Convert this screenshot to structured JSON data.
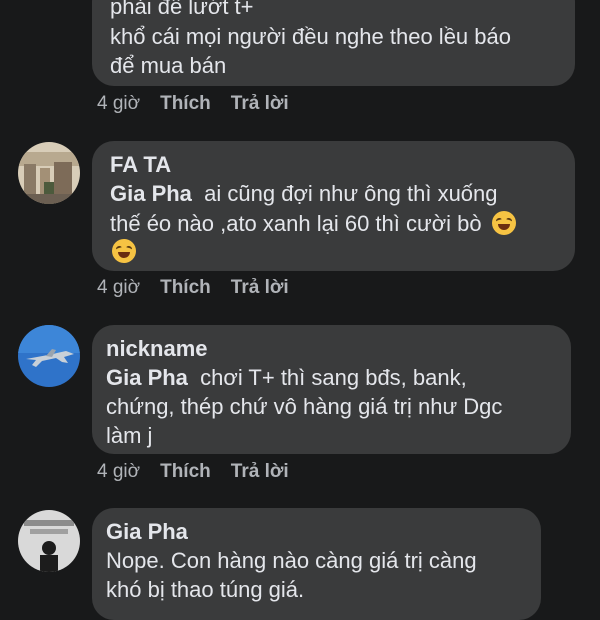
{
  "comment0": {
    "lines": [
      "phải để lướt t+",
      "khổ cái mọi người đều nghe theo lều báo",
      "để mua bán"
    ],
    "time": "4 giờ",
    "like": "Thích",
    "reply": "Trả lời"
  },
  "comment1": {
    "author": "FA TA",
    "mention": "Gia Pha",
    "line1": "ai cũng đợi như ông thì xuống",
    "line2": "thế éo nào ,ato xanh lại 60 thì cười bò",
    "emoji": "rolling-on-floor-laughing-emoji",
    "time": "4 giờ",
    "like": "Thích",
    "reply": "Trả lời"
  },
  "comment2": {
    "author": "nickname",
    "mention": "Gia Pha",
    "line1": "chơi T+ thì sang bđs, bank,",
    "line2": "chứng, thép chứ vô hàng giá trị như Dgc",
    "line3": "làm j",
    "time": "4 giờ",
    "like": "Thích",
    "reply": "Trả lời"
  },
  "comment3": {
    "author": "Gia Pha",
    "line1": "Nope. Con hàng nào càng giá trị càng",
    "line2": "khó bị thao túng giá."
  },
  "colors": {
    "bg": "#18191a",
    "bubble": "#3a3b3c",
    "text": "#e4e6eb",
    "meta": "#b0b3b8"
  }
}
